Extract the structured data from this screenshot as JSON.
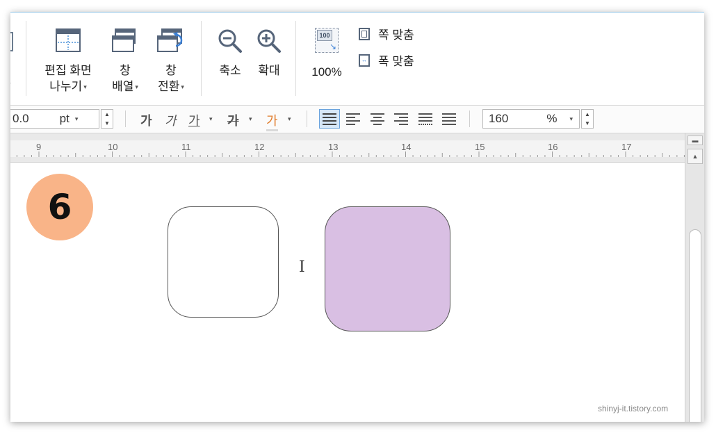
{
  "ribbon": {
    "edit_split": {
      "line1": "편집 화면",
      "line2": "나누기"
    },
    "window_arrange": {
      "line1": "창",
      "line2": "배열"
    },
    "window_switch": {
      "line1": "창",
      "line2": "전환"
    },
    "zoom_out": "축소",
    "zoom_in": "확대",
    "zoom_100": "100%",
    "zoom_100_icon_text": "100",
    "fit_page": "쪽 맞춤",
    "fit_width": "폭 맞춤"
  },
  "format_bar": {
    "font_size_value": "0.0",
    "font_size_unit": "pt",
    "char_styles": [
      "가",
      "가",
      "가",
      "가",
      "가"
    ],
    "line_spacing_value": "160",
    "line_spacing_unit": "%"
  },
  "ruler": {
    "labels": [
      "9",
      "10",
      "11",
      "12",
      "13",
      "14",
      "15",
      "16",
      "17"
    ]
  },
  "page": {
    "step_badge": "6",
    "purple_fill": "#d9bfe3",
    "badge_color": "#f9b488",
    "watermark": "shinyj-it.tistory.com"
  }
}
